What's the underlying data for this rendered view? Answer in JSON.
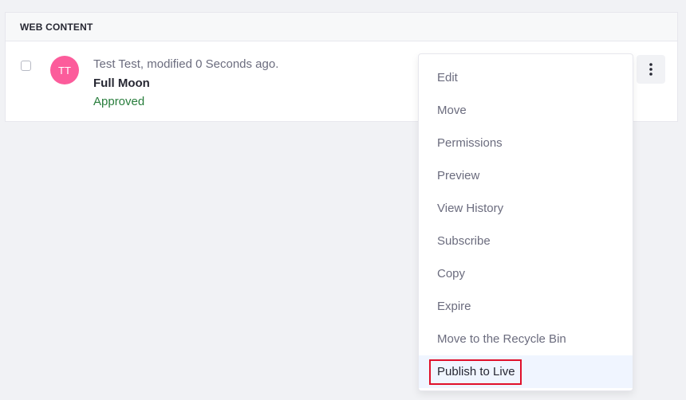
{
  "panel": {
    "header": "WEB CONTENT"
  },
  "entry": {
    "avatar_initials": "TT",
    "avatar_color": "#fc5c9b",
    "meta": "Test Test, modified 0 Seconds ago.",
    "title": "Full Moon",
    "status": "Approved",
    "status_color": "#287d3c"
  },
  "menu": {
    "items": [
      "Edit",
      "Move",
      "Permissions",
      "Preview",
      "View History",
      "Subscribe",
      "Copy",
      "Expire",
      "Move to the Recycle Bin",
      "Publish to Live"
    ]
  },
  "icons": {
    "actions": "ellipsis-vertical-icon"
  }
}
